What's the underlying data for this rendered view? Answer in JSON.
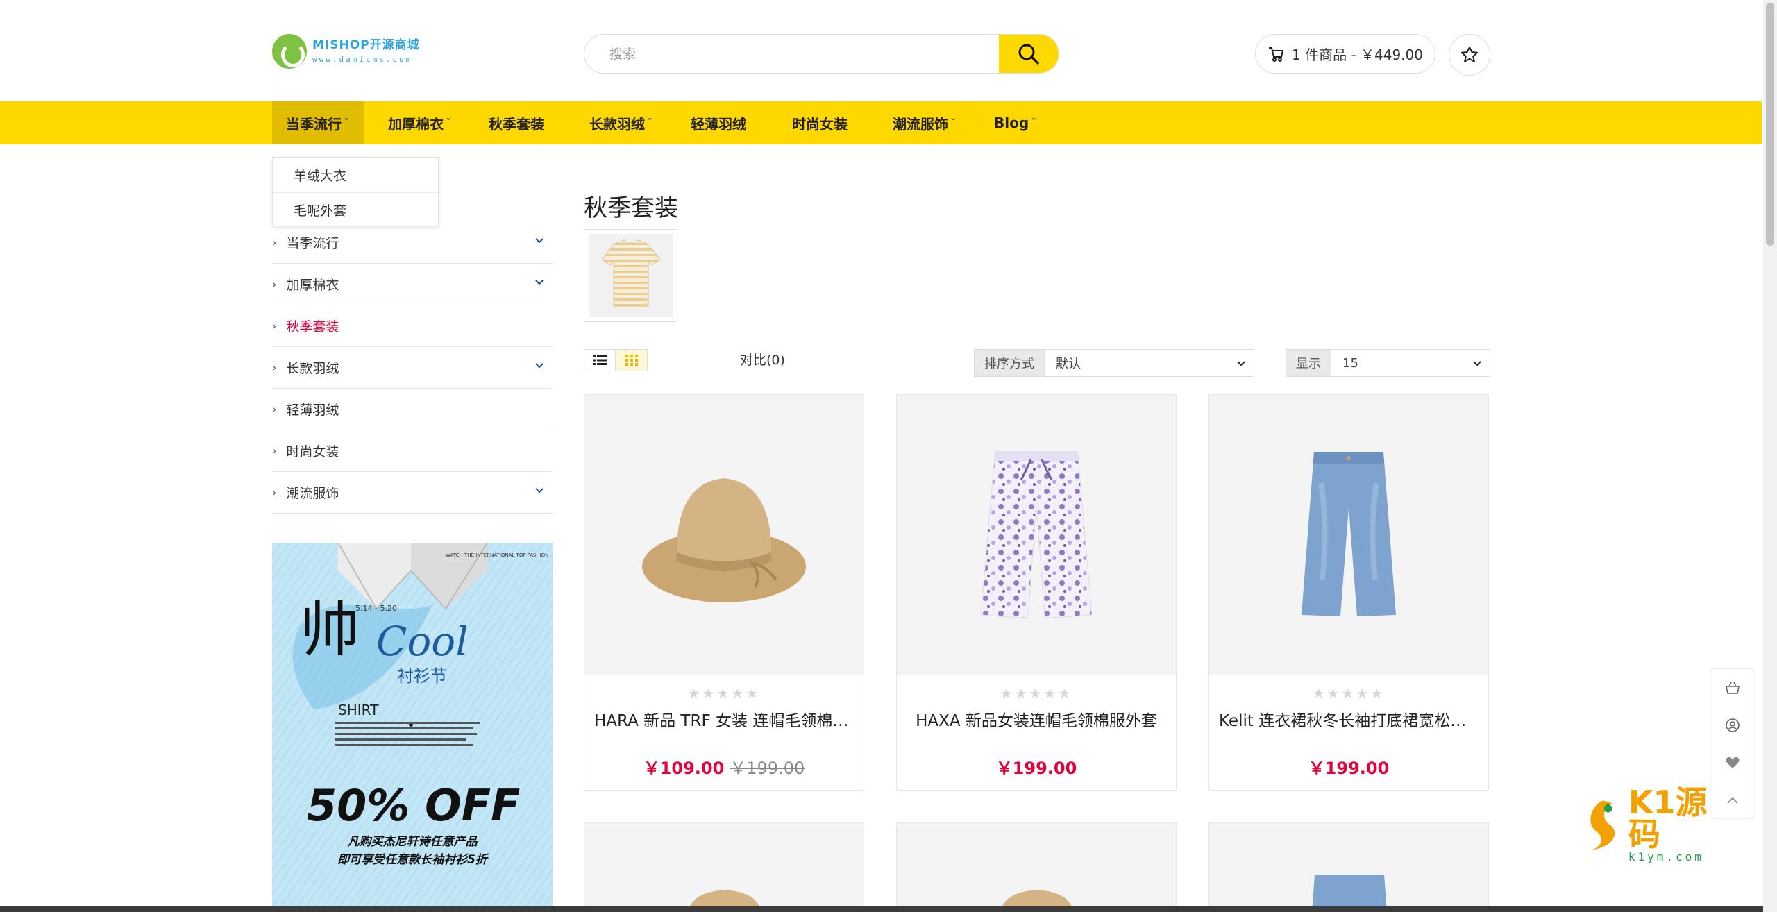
{
  "header": {
    "logo_name": "MISHOP开源商城",
    "logo_url": "www.damicms.com",
    "search_placeholder": "搜索",
    "cart_label": "1 件商品 - ￥449.00"
  },
  "nav": {
    "items": [
      {
        "label": "当季流行",
        "has_dropdown": true
      },
      {
        "label": "加厚棉衣",
        "has_dropdown": true
      },
      {
        "label": "秋季套装",
        "has_dropdown": false
      },
      {
        "label": "长款羽绒",
        "has_dropdown": true
      },
      {
        "label": "轻薄羽绒",
        "has_dropdown": false
      },
      {
        "label": "时尚女装",
        "has_dropdown": false
      },
      {
        "label": "潮流服饰",
        "has_dropdown": true
      },
      {
        "label": "Blog",
        "has_dropdown": true
      }
    ],
    "active_index": 0,
    "dropdown_items": [
      "羊绒大衣",
      "毛呢外套"
    ]
  },
  "sidebar": {
    "categories": [
      {
        "label": "当季流行",
        "expandable": true
      },
      {
        "label": "加厚棉衣",
        "expandable": true
      },
      {
        "label": "秋季套装",
        "expandable": false,
        "current": true
      },
      {
        "label": "长款羽绒",
        "expandable": true
      },
      {
        "label": "轻薄羽绒",
        "expandable": false
      },
      {
        "label": "时尚女装",
        "expandable": false
      },
      {
        "label": "潮流服饰",
        "expandable": true
      }
    ],
    "banner": {
      "big_char": "帅",
      "cool": "Cool",
      "festival": "衬衫节",
      "shirt": "SHIRT",
      "date": "5.14 - 5.20",
      "tagline": "WATCH THE INTERNATIONAL TOP FASHION",
      "offer": "50% OFF",
      "line1": "凡购买杰尼轩诗任意产品",
      "line2": "即可享受任意款长袖衬衫5折"
    }
  },
  "main": {
    "title": "秋季套装",
    "compare_label": "对比(0)",
    "sort_label": "排序方式",
    "sort_value": "默认",
    "show_label": "显示",
    "show_value": "15",
    "products": [
      {
        "title": "HARA 新品 TRF 女装 连帽毛领棉服外套",
        "price": "￥109.00",
        "old_price": "￥199.00",
        "image": "straw-hat"
      },
      {
        "title": "HAXA 新品女装连帽毛领棉服外套",
        "price": "￥199.00",
        "old_price": "",
        "image": "floral-pants"
      },
      {
        "title": "Kelit 连衣裙秋冬长袖打底裙宽松中长款",
        "price": "￥199.00",
        "old_price": "",
        "image": "denim-jeans"
      }
    ],
    "rating_stars": "★★★★★"
  },
  "watermark": {
    "name": "K1源码",
    "url": "k1ym.com"
  },
  "colors": {
    "accent_yellow": "#ffd800",
    "price_red": "#e4003a",
    "logo_blue": "#2da3e0"
  }
}
